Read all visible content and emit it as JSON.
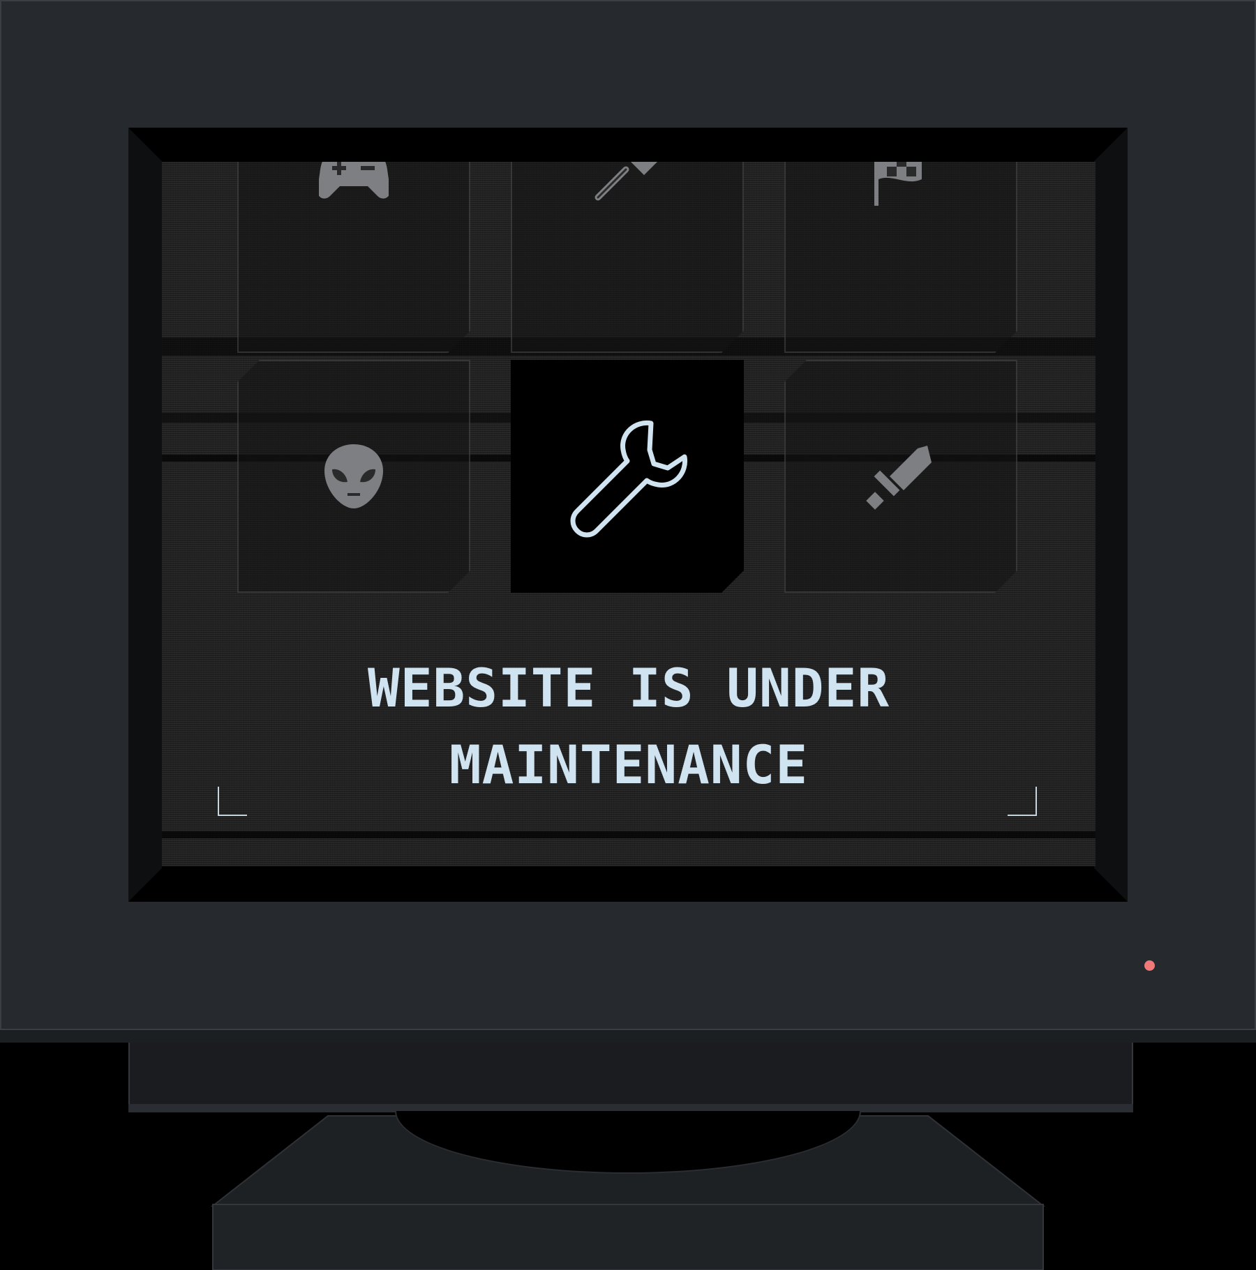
{
  "message": {
    "line1": "WEBSITE IS UNDER",
    "line2": "MAINTENANCE"
  },
  "tiles": [
    {
      "icon": "gamepad-icon",
      "state": "dim"
    },
    {
      "icon": "axe-icon",
      "state": "dim"
    },
    {
      "icon": "checkered-flag-icon",
      "state": "dim"
    },
    {
      "icon": "alien-icon",
      "state": "dim"
    },
    {
      "icon": "wrench-icon",
      "state": "active"
    },
    {
      "icon": "sword-icon",
      "state": "dim"
    }
  ],
  "colors": {
    "monitor_body": "#262a2e",
    "screen_bg": "#1b1b1b",
    "text": "#cfe3f1",
    "icon_dim": "#7d7f82",
    "power_led": "#f07a7a"
  }
}
